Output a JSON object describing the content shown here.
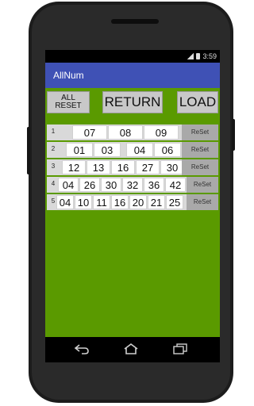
{
  "status": {
    "time": "3:59"
  },
  "app": {
    "title": "AllNum"
  },
  "buttons": {
    "all_reset": "ALL\nRESET",
    "return": "RETURN",
    "load": "LOAD"
  },
  "rows": [
    {
      "num": "1",
      "values": [
        "07",
        "08",
        "09"
      ],
      "reset": "ReSet"
    },
    {
      "num": "2",
      "values": [
        "01",
        "03",
        "04",
        "06"
      ],
      "reset": "ReSet"
    },
    {
      "num": "3",
      "values": [
        "12",
        "13",
        "16",
        "27",
        "30"
      ],
      "reset": "ReSet"
    },
    {
      "num": "4",
      "values": [
        "04",
        "26",
        "30",
        "32",
        "36",
        "42"
      ],
      "reset": "ReSet"
    },
    {
      "num": "5",
      "values": [
        "04",
        "10",
        "11",
        "16",
        "20",
        "21",
        "25"
      ],
      "reset": "ReSet"
    }
  ],
  "navbar": {
    "icons": [
      "back-icon",
      "home-icon",
      "recent-apps-icon"
    ]
  },
  "colors": {
    "actionbar": "#3f51b5",
    "content": "#5a9a00",
    "row": "#d9d9d9",
    "reset": "#a9a9a9"
  }
}
